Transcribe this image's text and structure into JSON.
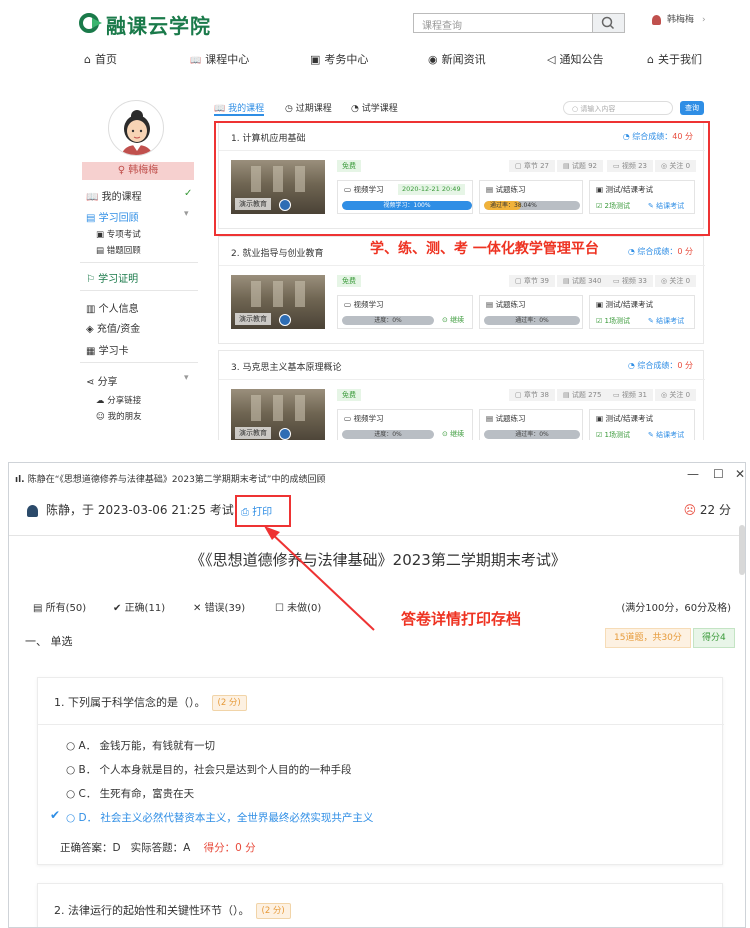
{
  "site": {
    "logo_text": "融课云学院",
    "search_placeholder": "课程查询",
    "user_name": "韩梅梅",
    "user_arrow": "›"
  },
  "nav": [
    {
      "icon": "home-icon",
      "glyph": "⌂",
      "label": "首页"
    },
    {
      "icon": "book-icon",
      "glyph": "📖",
      "label": "课程中心"
    },
    {
      "icon": "calendar-icon",
      "glyph": "▣",
      "label": "考务中心"
    },
    {
      "icon": "news-icon",
      "glyph": "◉",
      "label": "新闻资讯"
    },
    {
      "icon": "bell-icon",
      "glyph": "◁",
      "label": "通知公告"
    },
    {
      "icon": "about-icon",
      "glyph": "⌂",
      "label": "关于我们"
    }
  ],
  "sidebar": {
    "name": "韩梅梅",
    "my_courses": "我的课程",
    "study_review": "学习回顾",
    "special_exam": "专项考试",
    "wrong_review": "错题回顾",
    "certificate": "学习证明",
    "profile": "个人信息",
    "recharge": "充值/资金",
    "study_card": "学习卡",
    "share": "分享",
    "share_link": "分享链接",
    "my_friends": "我的朋友"
  },
  "tabs": {
    "my_courses": "我的课程",
    "expired": "过期课程",
    "trial": "试学课程",
    "search_placeholder": "请输入内容",
    "search_button": "查询"
  },
  "courses": [
    {
      "title": "1. 计算机应用基础",
      "score_label": "综合成绩：",
      "score_value": "40 分",
      "free": "免费",
      "chapters": "章节 27",
      "tests": "试题 92",
      "videos": "视频 23",
      "follows": "关注 0",
      "thumb_label": "演示教育",
      "video": "视频学习",
      "video_date": "2020-12-21 20:49",
      "video_progress_text": "视频学习：100%",
      "video_progress": 100,
      "practice": "试题练习",
      "practice_progress_text": "通过率：38.04%",
      "practice_progress": 38.04,
      "exam": "测试/结课考试",
      "exam_count": "2场测试",
      "exam_action": "结课考试"
    },
    {
      "title": "2. 就业指导与创业教育",
      "score_label": "综合成绩：",
      "score_value": "0 分",
      "free": "免费",
      "chapters": "章节 39",
      "tests": "试题 340",
      "videos": "视频 33",
      "follows": "关注 0",
      "thumb_label": "演示教育",
      "video": "视频学习",
      "video_progress_text": "进度：0%",
      "video_progress": 0,
      "video_action": "继续",
      "practice": "试题练习",
      "practice_progress_text": "通过率：0%",
      "practice_progress": 0,
      "exam": "测试/结课考试",
      "exam_count": "1场测试",
      "exam_action": "结课考试"
    },
    {
      "title": "3. 马克思主义基本原理概论",
      "score_label": "综合成绩：",
      "score_value": "0 分",
      "free": "免费",
      "chapters": "章节 38",
      "tests": "试题 275",
      "videos": "视频 31",
      "follows": "关注 0",
      "thumb_label": "演示教育",
      "video": "视频学习",
      "video_progress_text": "进度：0%",
      "video_progress": 0,
      "video_action": "继续",
      "practice": "试题练习",
      "practice_progress_text": "通过率：0%",
      "practice_progress": 0,
      "exam": "测试/结课考试",
      "exam_count": "1场测试",
      "exam_action": "结课考试"
    }
  ],
  "caption_top": "学、练、测、考 一体化教学管理平台",
  "caption_bottom": "答卷详情打印存档",
  "review": {
    "window_title": "陈静在“《思想道德修养与法律基础》2023第二学期期末考试”中的成绩回顾",
    "header": "陈静，于 2023-03-06 21:25 考试",
    "print": "打印",
    "score": "22 分",
    "exam_title": "《《思想道德修养与法律基础》2023第二学期期末考试》",
    "filter_all": "所有(50)",
    "filter_correct": "正确(11)",
    "filter_wrong": "错误(39)",
    "filter_undone": "未做(0)",
    "full_score": "(满分100分，60分及格)",
    "section": "一、 单选",
    "section_info": "15道题，共30分",
    "section_score": "得分4",
    "q1": {
      "title": "1. 下列属于科学信念的是（）。",
      "points": "(2 分)",
      "options": [
        "○ A．  金钱万能，有钱就有一切",
        "○ B．  个人本身就是目的，社会只是达到个人目的的一种手段",
        "○ C．  生死有命，富贵在天",
        "○ D．  社会主义必然代替资本主义，全世界最终必然实现共产主义"
      ],
      "correct": "正确答案：D",
      "actual": "实际答题：A",
      "got": "得分：0 分"
    },
    "q2": {
      "title": "2. 法律运行的起始性和关键性环节（）。",
      "points": "(2 分)"
    }
  },
  "colors": {
    "brand": "#1a7a4a",
    "link": "#2f8ee5",
    "highlight": "#e33333",
    "orange": "#e69a3a",
    "green": "#3a9a3a"
  }
}
